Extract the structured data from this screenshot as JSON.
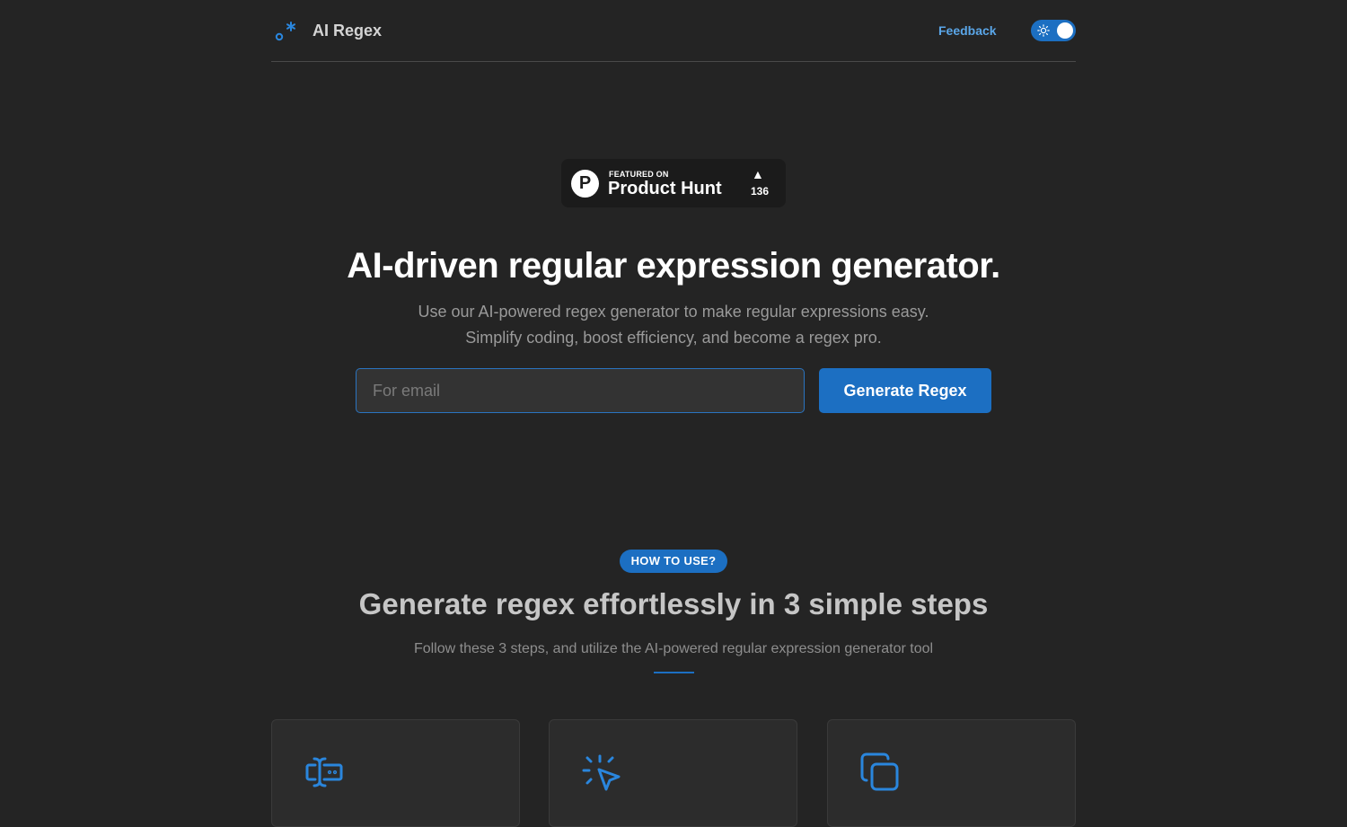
{
  "header": {
    "brand": "AI Regex",
    "feedback_label": "Feedback",
    "logo_icon": "regex-dot-star-icon",
    "theme_toggle_icon": "sun-icon"
  },
  "product_hunt": {
    "featured": "FEATURED ON",
    "name": "Product Hunt",
    "logo_letter": "P",
    "arrow": "▲",
    "count": "136"
  },
  "hero": {
    "title": "AI-driven regular expression generator.",
    "subtitle_line1": "Use our AI-powered regex generator to make regular expressions easy.",
    "subtitle_line2": "Simplify coding, boost efficiency, and become a regex pro.",
    "input_placeholder": "For email",
    "button_label": "Generate Regex"
  },
  "how_to": {
    "pill": "HOW TO USE?",
    "title": "Generate regex effortlessly in 3 simple steps",
    "subtitle": "Follow these 3 steps, and utilize the AI-powered regular expression generator tool"
  },
  "steps": [
    {
      "icon": "text-cursor-input-icon"
    },
    {
      "icon": "mouse-pointer-click-icon"
    },
    {
      "icon": "copy-icon"
    }
  ],
  "colors": {
    "background": "#242424",
    "accent": "#1c6fc2",
    "link": "#5aa6e8"
  }
}
